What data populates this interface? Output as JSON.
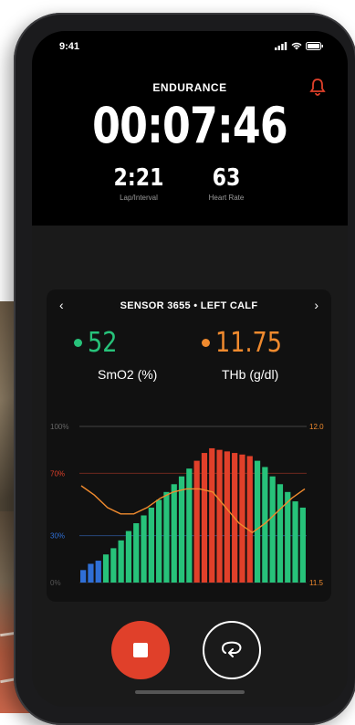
{
  "status_bar": {
    "time": "9:41",
    "icons": [
      "signal-icon",
      "wifi-icon",
      "battery-icon"
    ]
  },
  "workout": {
    "mode": "ENDURANCE",
    "timer": "00:07:46"
  },
  "stats": [
    {
      "value": "2:21",
      "label": "Lap/Interval"
    },
    {
      "value": "63",
      "label": "Heart Rate"
    }
  ],
  "sensor": {
    "title": "SENSOR 3655 • LEFT CALF",
    "prev_icon": "chevron-left-icon",
    "next_icon": "chevron-right-icon",
    "smo2": {
      "value": "52",
      "label": "SmO2 (%)",
      "color": "#27c27a"
    },
    "thb": {
      "value": "11.75",
      "label": "THb (g/dl)",
      "color": "#f08a2e"
    }
  },
  "colors": {
    "accent_red": "#e0402a",
    "zone_blue": "#2f6fd6",
    "zone_green": "#27c27a",
    "zone_red": "#e0402a",
    "thb_line": "#f08a2e"
  },
  "chart_data": {
    "type": "bar",
    "left_axis": {
      "ticks": [
        "100%",
        "70%",
        "30%",
        "0%"
      ]
    },
    "right_axis": {
      "ticks": [
        "12.0",
        "11.5"
      ]
    },
    "smo2_values": [
      8,
      12,
      14,
      18,
      22,
      27,
      33,
      38,
      43,
      48,
      53,
      58,
      63,
      68,
      73,
      78,
      83,
      86,
      85,
      84,
      83,
      82,
      81,
      78,
      74,
      68,
      63,
      58,
      52,
      48
    ],
    "bar_zones": [
      "blue",
      "blue",
      "blue",
      "green",
      "green",
      "green",
      "green",
      "green",
      "green",
      "green",
      "green",
      "green",
      "green",
      "green",
      "green",
      "red",
      "red",
      "red",
      "red",
      "red",
      "red",
      "red",
      "red",
      "green",
      "green",
      "green",
      "green",
      "green",
      "green",
      "green"
    ],
    "thb_values": [
      11.81,
      11.78,
      11.74,
      11.72,
      11.72,
      11.74,
      11.77,
      11.79,
      11.8,
      11.8,
      11.79,
      11.74,
      11.69,
      11.66,
      11.69,
      11.73,
      11.77,
      11.8
    ]
  },
  "controls": {
    "stop": "stop-icon",
    "lap": "lap-icon"
  }
}
